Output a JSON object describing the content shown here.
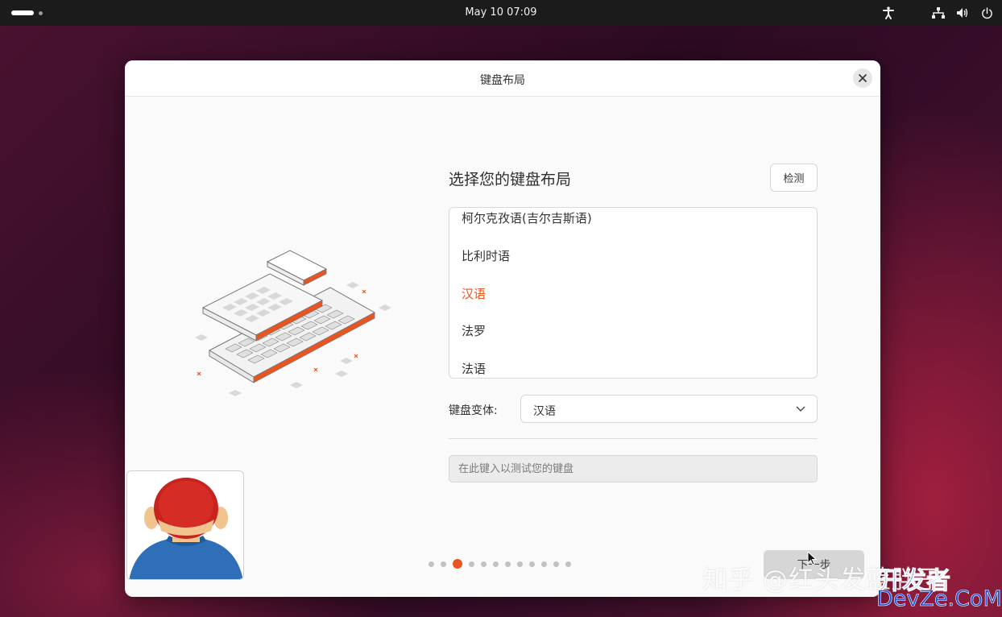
{
  "topbar": {
    "clock": "May 10  07:09",
    "icons": [
      "activities-icon",
      "accessibility-icon",
      "network-icon",
      "volume-icon",
      "power-icon"
    ]
  },
  "window": {
    "title": "键盘布局",
    "close_icon": "close-icon"
  },
  "keyboard": {
    "heading": "选择您的键盘布局",
    "detect_label": "检测",
    "layouts": [
      {
        "label": "柯尔克孜语(吉尔吉斯语)",
        "selected": false
      },
      {
        "label": "比利时语",
        "selected": false
      },
      {
        "label": "汉语",
        "selected": true
      },
      {
        "label": "法罗",
        "selected": false
      },
      {
        "label": "法语",
        "selected": false
      }
    ],
    "variant_label": "键盘变体:",
    "variant_value": "汉语",
    "test_placeholder": "在此键入以测试您的键盘"
  },
  "pagination": {
    "total": 12,
    "current": 3
  },
  "footer": {
    "next_label": "下一步"
  },
  "watermark": {
    "zhihu": "知乎 @红头发蓝胖子",
    "dev": "开发者",
    "devze": "DevZe.CoM"
  },
  "colors": {
    "accent": "#e95420",
    "topbar_bg": "#1b1b1b",
    "window_bg": "#fafafa"
  }
}
